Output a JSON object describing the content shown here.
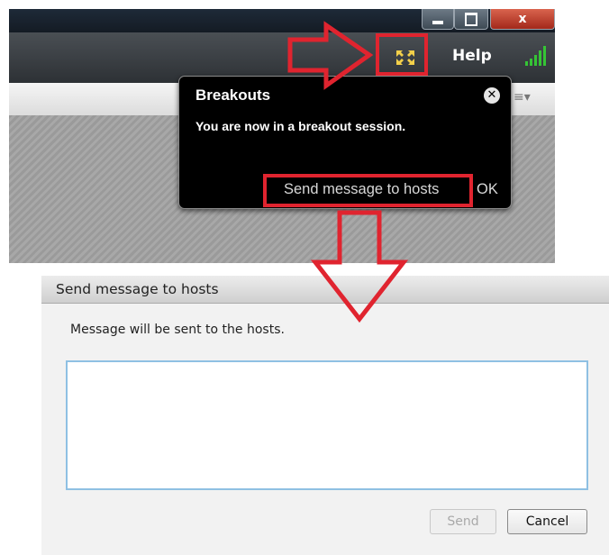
{
  "app": {
    "window_controls": {
      "close_glyph": "x"
    },
    "menubar": {
      "help_label": "Help"
    }
  },
  "popup": {
    "title": "Breakouts",
    "message": "You are now in a breakout session.",
    "send_label": "Send message to hosts",
    "ok_label": "OK"
  },
  "dialog": {
    "title": "Send message to hosts",
    "message": "Message will be sent to the hosts.",
    "input_value": "",
    "send_label": "Send",
    "cancel_label": "Cancel"
  },
  "icons": {
    "fullscreen": "fullscreen-icon",
    "signal": "signal-strength-icon",
    "popup_close": "close-icon",
    "pod_menu": "pod-menu-icon"
  },
  "colors": {
    "annotation": "#e0242f",
    "fullscreen_icon": "#f3d04a",
    "signal": "#35c435",
    "input_border": "#8fc0e3"
  }
}
